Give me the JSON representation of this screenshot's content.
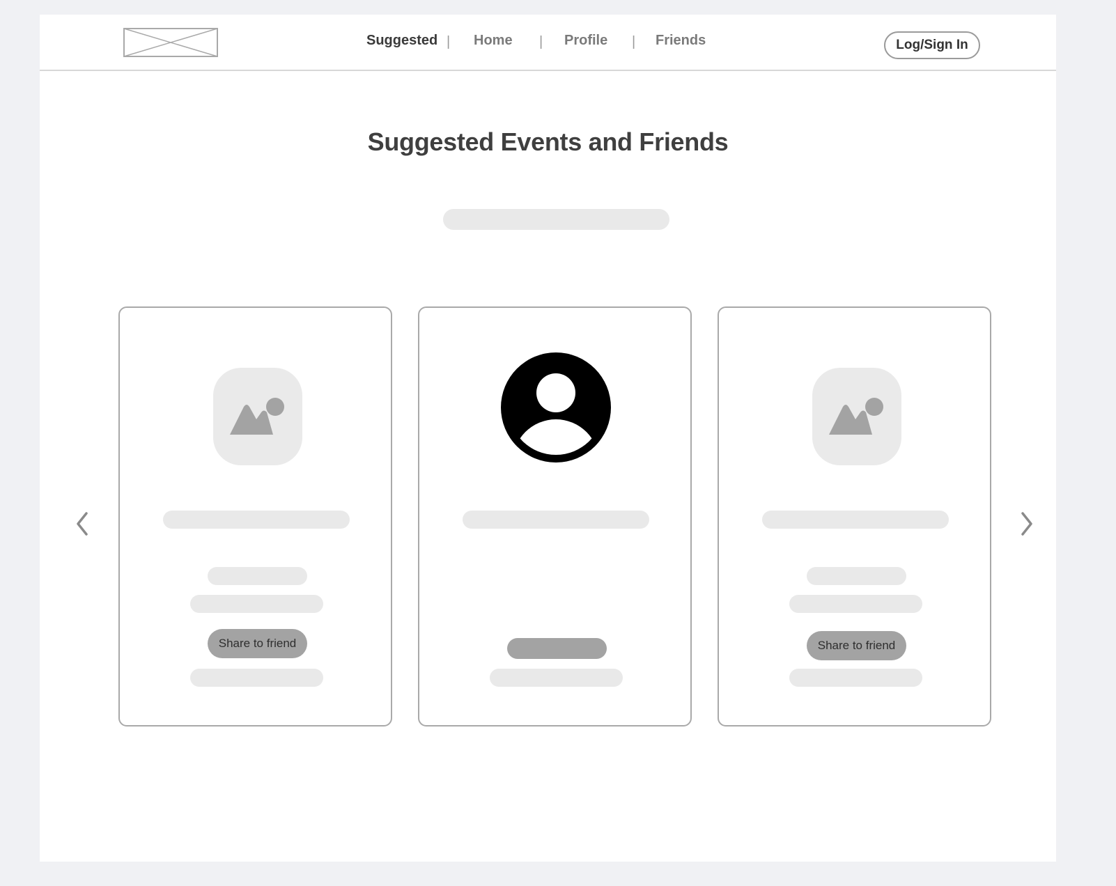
{
  "header": {
    "logo": "image-placeholder",
    "nav": [
      {
        "label": "Suggested",
        "active": true
      },
      {
        "label": "Home",
        "active": false
      },
      {
        "label": "Profile",
        "active": false
      },
      {
        "label": "Friends",
        "active": false
      }
    ],
    "separator": "|",
    "login_label": "Log/Sign In"
  },
  "main": {
    "title": "Suggested Events and Friends",
    "cards": [
      {
        "type": "event",
        "icon": "image-icon",
        "button_label": "Share to friend"
      },
      {
        "type": "friend",
        "icon": "user-avatar-icon"
      },
      {
        "type": "event",
        "icon": "image-icon",
        "button_label": "Share to friend"
      }
    ],
    "prev_icon": "chevron-left-icon",
    "next_icon": "chevron-right-icon"
  },
  "colors": {
    "background": "#f0f1f4",
    "placeholder": "#e9e9e9",
    "button": "#a3a3a3",
    "border": "#a9a9a9",
    "text_dark": "#3f3f3f"
  }
}
